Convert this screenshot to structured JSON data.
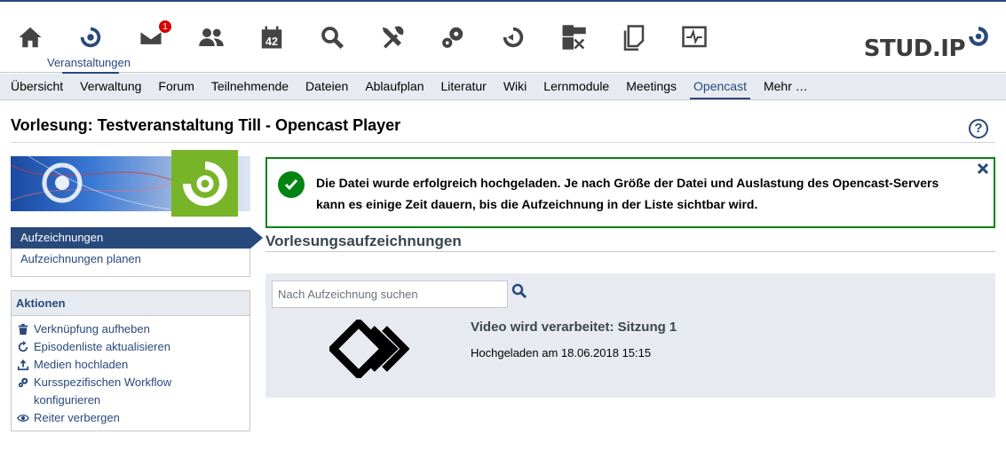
{
  "nav": {
    "items": [
      {
        "name": "home-icon"
      },
      {
        "name": "courses-icon",
        "label": "Veranstaltungen",
        "active": true
      },
      {
        "name": "mail-icon",
        "badge": "1"
      },
      {
        "name": "community-icon"
      },
      {
        "name": "calendar-icon",
        "text": "42"
      },
      {
        "name": "search-icon"
      },
      {
        "name": "tools-icon"
      },
      {
        "name": "admin-icon"
      },
      {
        "name": "studip-icon"
      },
      {
        "name": "evaluation-icon"
      },
      {
        "name": "files-icon"
      },
      {
        "name": "monitor-icon"
      }
    ],
    "logo_text": "STUD.IP"
  },
  "tabs": [
    {
      "label": "Übersicht"
    },
    {
      "label": "Verwaltung"
    },
    {
      "label": "Forum"
    },
    {
      "label": "Teilnehmende"
    },
    {
      "label": "Dateien"
    },
    {
      "label": "Ablaufplan"
    },
    {
      "label": "Literatur"
    },
    {
      "label": "Wiki"
    },
    {
      "label": "Lernmodule"
    },
    {
      "label": "Meetings"
    },
    {
      "label": "Opencast",
      "active": true
    },
    {
      "label": "Mehr …"
    }
  ],
  "page_title": "Vorlesung: Testveranstaltung Till - Opencast Player",
  "help": "?",
  "subnav": {
    "items": [
      {
        "label": "Aufzeichnungen",
        "active": true
      },
      {
        "label": "Aufzeichnungen planen"
      }
    ]
  },
  "actions": {
    "heading": "Aktionen",
    "items": [
      {
        "icon": "trash-icon",
        "label": "Verknüpfung aufheben"
      },
      {
        "icon": "refresh-icon",
        "label": "Episodenliste aktualisieren"
      },
      {
        "icon": "upload-icon",
        "label": "Medien hochladen"
      },
      {
        "icon": "workflow-icon",
        "label": "Kursspezifischen Workflow",
        "label2": "konfigurieren"
      },
      {
        "icon": "eye-icon",
        "label": "Reiter verbergen"
      }
    ]
  },
  "message": {
    "type": "success",
    "text": "Die Datei wurde erfolgreich hochgeladen. Je nach Größe der Datei und Auslastung des Opencast-Servers kann es einige Zeit dauern, bis die Aufzeichnung in der Liste sichtbar wird."
  },
  "section_title": "Vorlesungsaufzeichnungen",
  "search": {
    "placeholder": "Nach Aufzeichnung suchen",
    "value": ""
  },
  "recording": {
    "title": "Video wird verarbeitet: Sitzung 1",
    "date": "Hochgeladen am 18.06.2018 15:15"
  },
  "colors": {
    "accent": "#28497c",
    "success": "#008512",
    "opencast_green": "#78b428",
    "badge": "#d60000"
  }
}
